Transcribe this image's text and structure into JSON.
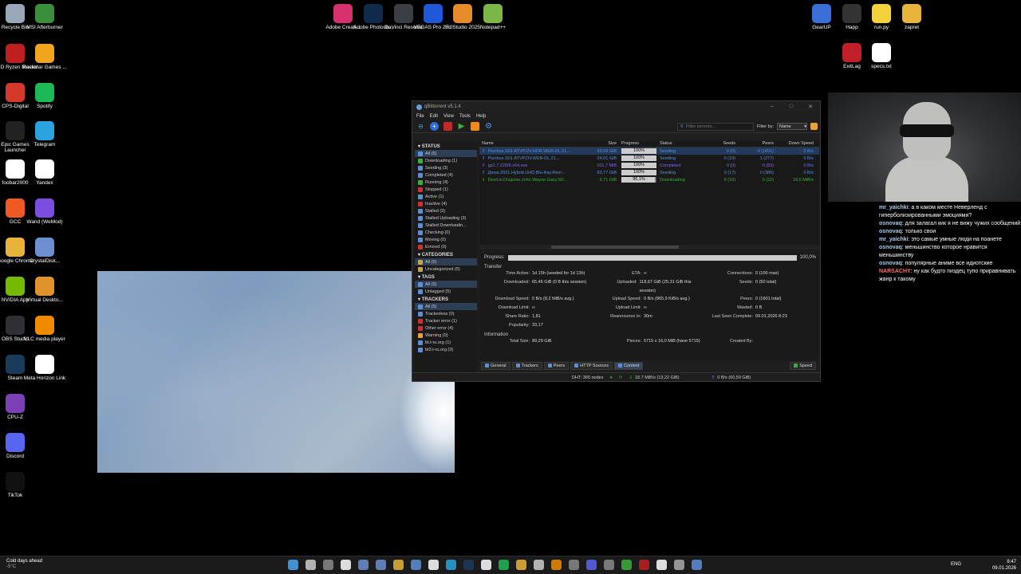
{
  "desktop_icons": [
    {
      "label": "Recycle Bin",
      "icon": "recycle-bin-icon",
      "color": "#9aa7b8"
    },
    {
      "label": "MSI Afterburner",
      "icon": "msi-afterburner-icon",
      "color": "#3a8f3a"
    },
    {
      "label": "AMD Ryzen Master",
      "icon": "amd-ryzen-icon",
      "color": "#c01f1f"
    },
    {
      "label": "Rockstar Games ...",
      "icon": "rockstar-icon",
      "color": "#f1a51c"
    },
    {
      "label": "CPS-Digital",
      "icon": "cps-digital-icon",
      "color": "#d6392a"
    },
    {
      "label": "Spotify",
      "icon": "spotify-icon",
      "color": "#1db954"
    },
    {
      "label": "Epic Games Launcher",
      "icon": "epic-games-icon",
      "color": "#222222"
    },
    {
      "label": "Telegram",
      "icon": "telegram-icon",
      "color": "#2aa3df"
    },
    {
      "label": "foobar2000",
      "icon": "foobar-icon",
      "color": "#ffffff"
    },
    {
      "label": "Yandex",
      "icon": "yandex-icon",
      "color": "#ffffff"
    },
    {
      "label": "GCC",
      "icon": "gcc-icon",
      "color": "#f05a22"
    },
    {
      "label": "Wand (WeMod)",
      "icon": "wemod-icon",
      "color": "#7b4de0"
    },
    {
      "label": "Google Chrome",
      "icon": "chrome-icon",
      "color": "#e9b33a"
    },
    {
      "label": "CrystalDisk...",
      "icon": "crystaldisk-icon",
      "color": "#6b8fd0"
    },
    {
      "label": "NVIDIA App",
      "icon": "nvidia-icon",
      "color": "#76b900"
    },
    {
      "label": "Virtual Deskto...",
      "icon": "virtual-desktop-icon",
      "color": "#e0932a"
    },
    {
      "label": "OBS Studio",
      "icon": "obs-icon",
      "color": "#302f36"
    },
    {
      "label": "VLC media player",
      "icon": "vlc-icon",
      "color": "#f08a00"
    },
    {
      "label": "Steam",
      "icon": "steam-icon",
      "color": "#1b3a5c"
    },
    {
      "label": "Meta Horizon Link",
      "icon": "meta-icon",
      "color": "#ffffff"
    },
    {
      "label": "CPU-Z",
      "icon": "cpuz-icon",
      "color": "#7d3fb5"
    },
    {
      "label": "Discord",
      "icon": "discord-icon",
      "color": "#5865f2"
    },
    {
      "label": "TikTok",
      "icon": "tiktok-icon",
      "color": "#111111"
    }
  ],
  "top_icons": [
    {
      "label": "Adobe Creati...",
      "icon": "adobe-cc-icon",
      "color": "#d7306f"
    },
    {
      "label": "Adobe Photosh...",
      "icon": "photoshop-icon",
      "color": "#0f2b4a"
    },
    {
      "label": "DaVinci Resolve",
      "icon": "davinci-icon",
      "color": "#3a3f46"
    },
    {
      "label": "VEGAS Pro 23.0",
      "icon": "vegas-icon",
      "color": "#1f58d6"
    },
    {
      "label": "FL Studio 2025",
      "icon": "fl-studio-icon",
      "color": "#e58b2a"
    },
    {
      "label": "Notepad++",
      "icon": "notepadpp-icon",
      "color": "#7ab648"
    },
    {
      "label": "GearUP",
      "icon": "gearup-icon",
      "color": "#3a6fd8"
    },
    {
      "label": "Happ",
      "icon": "happ-icon",
      "color": "#333333"
    },
    {
      "label": "run.py",
      "icon": "python-file-icon",
      "color": "#f3d23b"
    },
    {
      "label": "zapret",
      "icon": "folder-icon",
      "color": "#e8b43a"
    },
    {
      "label": "ExitLag",
      "icon": "exitlag-icon",
      "color": "#c01f2a"
    },
    {
      "label": "specs.txt",
      "icon": "text-file-icon",
      "color": "#ffffff"
    }
  ],
  "window": {
    "title": "qBittorrent v5.1.4",
    "menu": [
      "File",
      "Edit",
      "View",
      "Tools",
      "Help"
    ],
    "search_placeholder": "Filter torrents...",
    "filter_label": "Filter by:",
    "filter_value": "Name",
    "status_title": "STATUS",
    "status_items": [
      {
        "label": "All (5)",
        "color": "#5b8fd8",
        "selected": true
      },
      {
        "label": "Downloading (1)",
        "color": "#3ab03a",
        "selected": false
      },
      {
        "label": "Seeding (3)",
        "color": "#5b8fd8",
        "selected": false
      },
      {
        "label": "Completed (4)",
        "color": "#5b8fd8",
        "selected": false
      },
      {
        "label": "Running (4)",
        "color": "#3ab03a",
        "selected": false
      },
      {
        "label": "Stopped (1)",
        "color": "#d03030",
        "selected": false
      },
      {
        "label": "Active (1)",
        "color": "#5b8fd8",
        "selected": false
      },
      {
        "label": "Inactive (4)",
        "color": "#d03030",
        "selected": false
      },
      {
        "label": "Stalled (3)",
        "color": "#5b8fd8",
        "selected": false
      },
      {
        "label": "Stalled Uploading (3)",
        "color": "#5b8fd8",
        "selected": false
      },
      {
        "label": "Stalled Downloadin...",
        "color": "#5b8fd8",
        "selected": false
      },
      {
        "label": "Checking (0)",
        "color": "#5b8fd8",
        "selected": false
      },
      {
        "label": "Moving (0)",
        "color": "#5b8fd8",
        "selected": false
      },
      {
        "label": "Errored (0)",
        "color": "#d03030",
        "selected": false
      }
    ],
    "categories_title": "CATEGORIES",
    "categories": [
      {
        "label": "All (5)",
        "selected": true
      },
      {
        "label": "Uncategorized (5)",
        "selected": false
      }
    ],
    "tags_title": "TAGS",
    "tags": [
      {
        "label": "All (5)",
        "selected": true
      },
      {
        "label": "Untagged (5)",
        "selected": false
      }
    ],
    "trackers_title": "TRACKERS",
    "trackers": [
      {
        "label": "All (5)",
        "color": "#5b8fd8",
        "selected": true
      },
      {
        "label": "Trackerless (0)",
        "color": "#5b8fd8",
        "selected": false
      },
      {
        "label": "Tracker error (1)",
        "color": "#d03030",
        "selected": false
      },
      {
        "label": "Other error (4)",
        "color": "#d03030",
        "selected": false
      },
      {
        "label": "Warning (0)",
        "color": "#e8a23a",
        "selected": false
      },
      {
        "label": "bt.t-ru.org (1)",
        "color": "#5b8fd8",
        "selected": false
      },
      {
        "label": "bt3.t-ru.org (3)",
        "color": "#5b8fd8",
        "selected": false
      }
    ],
    "columns": [
      "Name",
      "Size",
      "Progress",
      "Status",
      "Seeds",
      "Peers",
      "Down Speed"
    ],
    "torrents": [
      {
        "name": "Pluribus.S01.ATVP.DV.HDR.WEB-DL.21...",
        "size": "59,09 GiB",
        "progress": "100%",
        "progress_value": 1.0,
        "status": "Seeding",
        "seeds": "0 (0)",
        "peers": "0 (1601)",
        "down": "0 B/s",
        "color": "#5b8fd8",
        "selected": true
      },
      {
        "name": "Pluribus.S01.ATVP.DV.WEB-DL.21...",
        "size": "24,01 GiB",
        "progress": "100%",
        "progress_value": 1.0,
        "status": "Seeding",
        "seeds": "0 (19)",
        "peers": "1 (277)",
        "down": "0 B/s",
        "color": "#5b8fd8",
        "selected": false
      },
      {
        "name": "gp1.7.226f9.x64.exe",
        "size": "101,7 MiB",
        "progress": "100%",
        "progress_value": 1.0,
        "status": "Completed",
        "seeds": "0 (0)",
        "peers": "0 (83)",
        "down": "0 B/s",
        "color": "#7b68ee",
        "selected": false
      },
      {
        "name": "Дюна.2021.Hybrid.UHD.Blu-Ray.Rem...",
        "size": "83,77 GiB",
        "progress": "100%",
        "progress_value": 1.0,
        "status": "Seeding",
        "seeds": "0 (17)",
        "peers": "0 (386)",
        "down": "0 B/s",
        "color": "#5b8fd8",
        "selected": false
      },
      {
        "name": "Devil.in.Disguise.John.Wayne.Gacy.S0...",
        "size": "6,71 GiB",
        "progress": "96,1%",
        "progress_value": 0.961,
        "status": "Downloading",
        "seeds": "9 (10)",
        "peers": "0 (22)",
        "down": "18,6 MiB/s",
        "color": "#3ab03a",
        "selected": false
      }
    ],
    "progress_label": "Progress:",
    "progress_value_text": "100,0%",
    "progress_fraction": 1.0,
    "transfer_title": "Transfer",
    "transfer": [
      {
        "k": "Time Active:",
        "v": "1d 15h (seeded for 1d 13h)"
      },
      {
        "k": "ETA:",
        "v": "∞"
      },
      {
        "k": "Connections:",
        "v": "0 (100 max)"
      },
      {
        "k": "Downloaded:",
        "v": "65,46 GiB (0 B this session)"
      },
      {
        "k": "Uploaded:",
        "v": "118,67 GiB (25,31 GiB this session)"
      },
      {
        "k": "Seeds:",
        "v": "0 (50 total)"
      },
      {
        "k": "Download Speed:",
        "v": "0 B/s (8,2 MiB/s avg.)"
      },
      {
        "k": "Upload Speed:",
        "v": "0 B/s (865,9 KiB/s avg.)"
      },
      {
        "k": "Peers:",
        "v": "0 (1601 total)"
      },
      {
        "k": "Download Limit:",
        "v": "∞"
      },
      {
        "k": "Upload Limit:",
        "v": "∞"
      },
      {
        "k": "Wasted:",
        "v": "0 B"
      },
      {
        "k": "Share Ratio:",
        "v": "1,81"
      },
      {
        "k": "Reannounce In:",
        "v": "30m"
      },
      {
        "k": "Last Seen Complete:",
        "v": "09.01.2026 8:23"
      },
      {
        "k": "Popularity:",
        "v": "33,17"
      },
      {
        "k": "",
        "v": ""
      },
      {
        "k": "",
        "v": ""
      }
    ],
    "information_title": "Information",
    "information": [
      {
        "k": "Total Size:",
        "v": "89,29 GiB"
      },
      {
        "k": "Pieces:",
        "v": "5715 x 16,0 MiB (have 5715)"
      },
      {
        "k": "Created By:",
        "v": ""
      }
    ],
    "detail_tabs": [
      "General",
      "Trackers",
      "Peers",
      "HTTP Sources",
      "Content"
    ],
    "speed_button": "Speed",
    "status_dht": "DHT: 365 nodes",
    "status_down": "18,7 MiB/s (13,22 GiB)",
    "status_up": "0 B/s (60,59 GiB)"
  },
  "chat": [
    {
      "user": "mr_yaichki",
      "text": ": а в каком месте Неверленд с гиперболизированными эмоциями?"
    },
    {
      "user": "osnovaq",
      "text": ": для залагал кик я не вижу чужих сообщений"
    },
    {
      "user": "osnovaq",
      "text": ": только свои"
    },
    {
      "user": "mr_yaichki",
      "text": ": это самые умные люди на поанете"
    },
    {
      "user": "osnovaq",
      "text": ": меньшинство которое нравится меньшинству"
    },
    {
      "user": "osnovaq",
      "text": ": популярные аниме все идиотские"
    },
    {
      "user": "NARSACHY",
      "text": ": ну как будто пиздец тупо приравнивать жанр к такому"
    }
  ],
  "taskbar": {
    "weather_title": "Cold days ahead",
    "weather_temp": "-5°C",
    "lang": "ENG",
    "time": "8:47",
    "date": "09.01.2026"
  }
}
